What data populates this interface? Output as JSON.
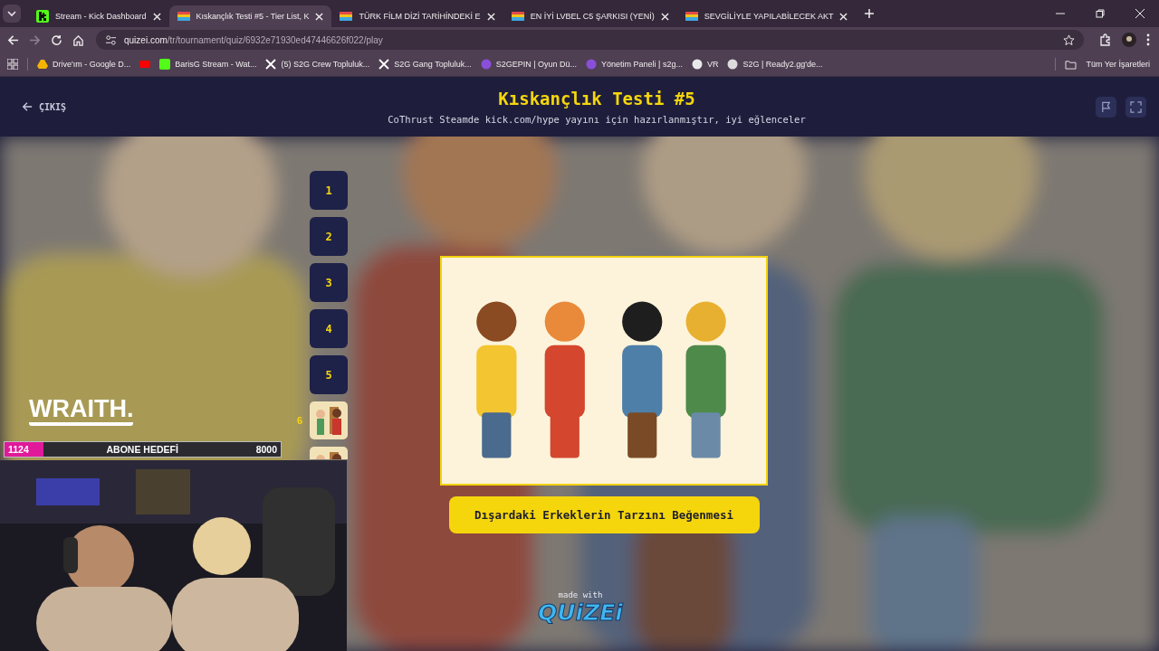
{
  "browser": {
    "tabs": [
      {
        "title": "Stream - Kick Dashboard",
        "kind": "kick",
        "selected": false
      },
      {
        "title": "Kıskançlık Testi #5 - Tier List, K",
        "kind": "quizei",
        "selected": true
      },
      {
        "title": "TÜRK FİLM DİZİ TARİHİNDEKİ E",
        "kind": "quizei",
        "selected": false
      },
      {
        "title": "EN İYİ LVBEL C5 ŞARKISI (YENİ)",
        "kind": "quizei",
        "selected": false
      },
      {
        "title": "SEVGİLİYLE YAPILABİLECEK AKT",
        "kind": "quizei",
        "selected": false
      }
    ],
    "address": {
      "host": "quizei.com",
      "path": "/tr/tournament/quiz/6932e71930ed47446626f022/play"
    },
    "bookmarks": [
      {
        "label": "Drive'ım - Google D...",
        "kind": "drive"
      },
      {
        "kind": "youtube"
      },
      {
        "label": "BarisG Stream - Wat...",
        "kind": "kick"
      },
      {
        "label": "(5) S2G Crew Topluluk...",
        "kind": "x"
      },
      {
        "label": "S2G Gang Topluluk...",
        "kind": "x"
      },
      {
        "label": "S2GEPIN | Oyun Dü...",
        "kind": "s2g"
      },
      {
        "label": "Yönetim Paneli | s2g...",
        "kind": "s2g"
      },
      {
        "label": "VR",
        "kind": "vr"
      },
      {
        "label": "S2G | Ready2.gg'de...",
        "kind": "globe"
      }
    ],
    "all_bookmarks": "Tüm Yer İşaretleri"
  },
  "quiz": {
    "exit": "ÇIKIŞ",
    "title": "Kıskançlık Testi #5",
    "subtitle": "CoThrust Steamde kick.com/hype yayını için hazırlanmıştır, iyi eğlenceler",
    "items": [
      {
        "kind": "number",
        "label": "1"
      },
      {
        "kind": "number",
        "label": "2"
      },
      {
        "kind": "number",
        "label": "3"
      },
      {
        "kind": "number",
        "label": "4"
      },
      {
        "kind": "number",
        "label": "5"
      },
      {
        "kind": "thumbnail",
        "label": "6"
      },
      {
        "kind": "thumbnail"
      }
    ],
    "caption": "Dışardaki Erkeklerin Tarzını Beğenmesi",
    "made_with": "made with",
    "logo": "QUiZEi"
  },
  "stream_overlay": {
    "sponsor": "WRAITH.",
    "goal": {
      "current": "1124",
      "label": "ABONE HEDEFİ",
      "target": "8000",
      "level": 0.14
    }
  }
}
